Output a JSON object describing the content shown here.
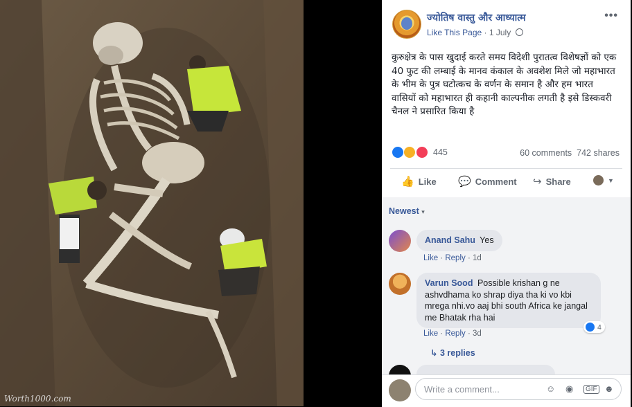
{
  "photo": {
    "watermark": "Worth1000.com"
  },
  "post": {
    "page_name": "ज्योतिष वास्तु और आध्यात्म",
    "like_page": "Like This Page",
    "date": "1 July",
    "more_icon": "more-horizontal-icon",
    "text": "कुरुक्षेत्र के पास खुदाई करते समय विदेशी पुरातत्व विशेषज्ञों को एक 40 फुट की लम्बाई के मानव कंकाल के अवशेश मिले जो महाभारत के भीम के पुत्र घटोत्कच के वर्णन के समान है और हम भारत वासियों को महाभारत ही कहानी काल्पनीक लगती है इसे डिस्कवरी चैनल ने प्रसारित किया है",
    "reaction_count": "445",
    "comments_count": "60 comments",
    "shares_count": "742 shares",
    "colors": {
      "link": "#385898",
      "like": "#1877f2",
      "wow": "#f7b125",
      "love": "#f33e58"
    }
  },
  "actions": {
    "like": "Like",
    "comment": "Comment",
    "share": "Share"
  },
  "comments": {
    "sort": "Newest",
    "items": [
      {
        "name": "Anand Sahu",
        "text": "Yes",
        "like": "Like",
        "reply": "Reply",
        "age": "1d"
      },
      {
        "name": "Varun Sood",
        "text_lines": [
          "Possible krishan g ne",
          "ashvdhama ko shrap diya tha ki vo kbi",
          "mrega nhi.vo aaj bhi south Africa ke jangal",
          "me Bhatak rha hai"
        ],
        "like": "Like",
        "reply": "Reply",
        "age": "3d",
        "reaction_count": "4",
        "replies": "3 replies"
      }
    ],
    "write_placeholder": "Write a comment..."
  }
}
